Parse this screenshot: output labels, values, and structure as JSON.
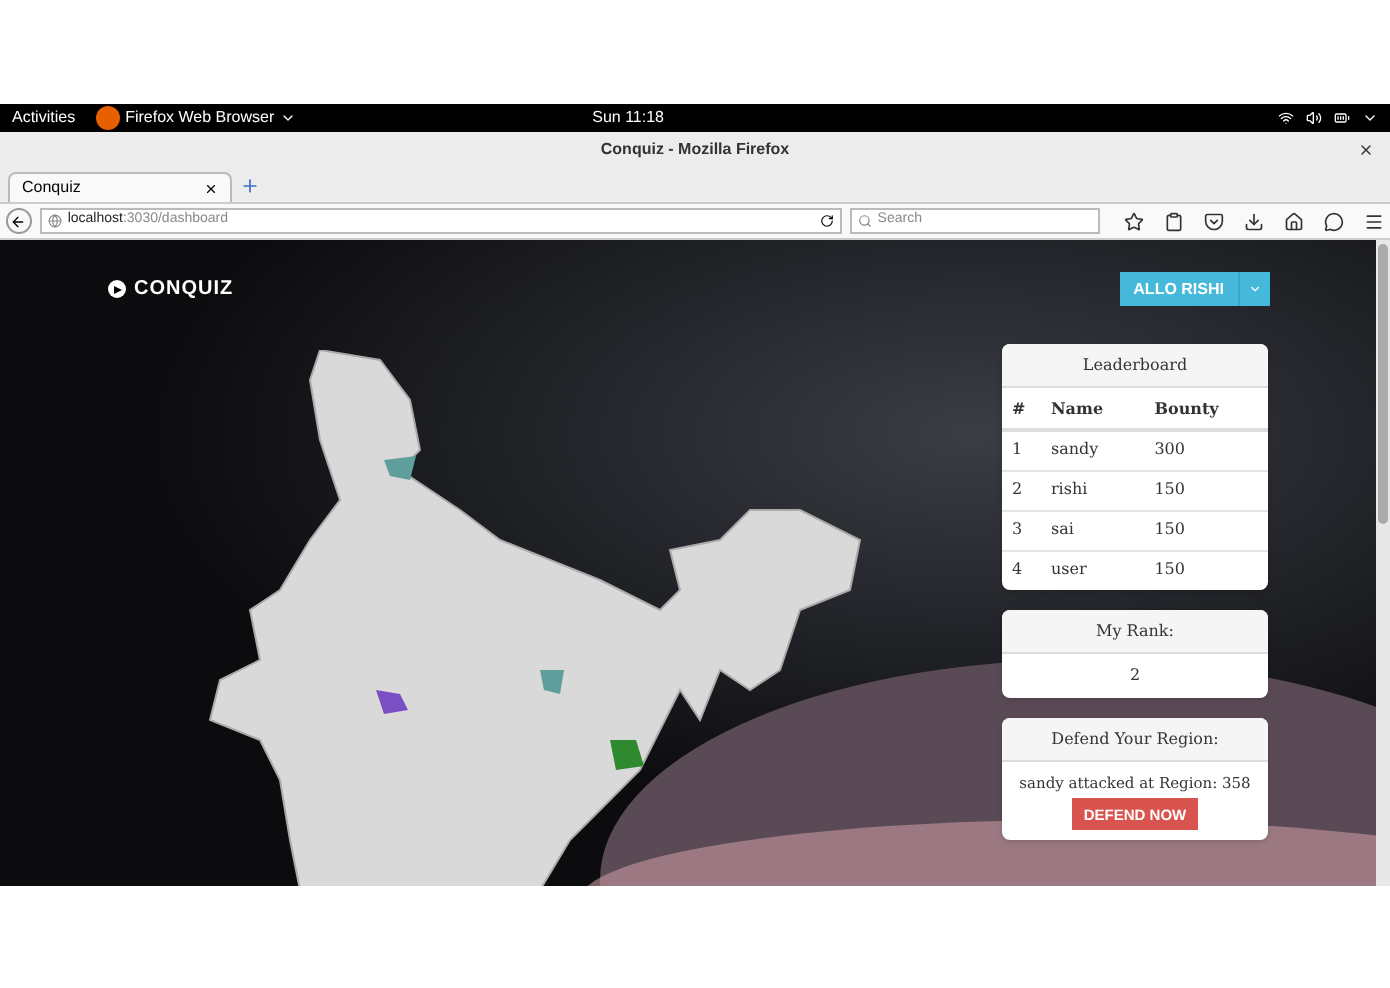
{
  "topbar": {
    "activities": "Activities",
    "app": "Firefox Web Browser",
    "clock": "Sun 11:18"
  },
  "browser": {
    "window_title": "Conquiz - Mozilla Firefox",
    "tab": {
      "label": "Conquiz",
      "selected": true
    },
    "url_host": "localhost",
    "url_path": ":3030/dashboard",
    "search_placeholder": "Search"
  },
  "page": {
    "logo": "CONQUIZ",
    "user_button": "ALLO RISHI",
    "leaderboard": {
      "title": "Leaderboard",
      "columns": [
        "#",
        "Name",
        "Bounty"
      ],
      "rows": [
        [
          "1",
          "sandy",
          "300"
        ],
        [
          "2",
          "rishi",
          "150"
        ],
        [
          "3",
          "sai",
          "150"
        ],
        [
          "4",
          "user",
          "150"
        ]
      ]
    },
    "rank": {
      "title": "My Rank:",
      "value": "2"
    },
    "defend": {
      "title": "Defend Your Region:",
      "message": "sandy attacked at Region: 358",
      "button": "DEFEND NOW"
    }
  }
}
